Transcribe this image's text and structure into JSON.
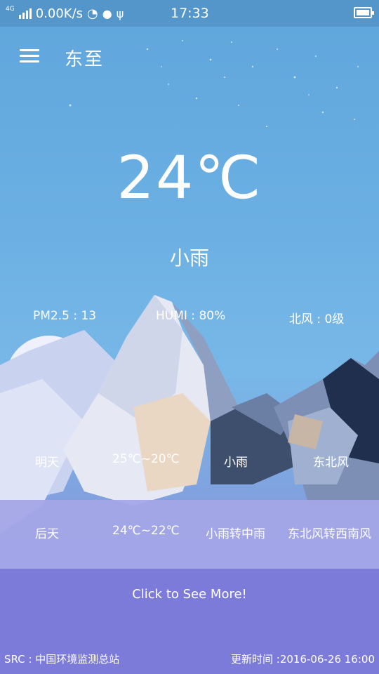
{
  "status_bar": {
    "network": "4G",
    "speed": "0.00K/s",
    "time": "17:33"
  },
  "header": {
    "city": "东至"
  },
  "current": {
    "temperature": "24℃",
    "condition": "小雨"
  },
  "metrics": [
    {
      "label": "PM2.5 : 13"
    },
    {
      "label": "HUMI : 80%"
    },
    {
      "label": "北风 : 0级"
    }
  ],
  "forecast": [
    {
      "day": "明天",
      "temp": "25℃~20℃",
      "weather": "小雨",
      "wind": "东北风"
    },
    {
      "day": "后天",
      "temp": "24℃~22℃",
      "weather": "小雨转中雨",
      "wind": "东北风转西南风"
    }
  ],
  "more_link": "Click to See More!",
  "footer": {
    "source": "SRC : 中国环境监测总站",
    "updated": "更新时间 :2016-06-26 16:00"
  },
  "colors": {
    "sky_top": "#5fa6dc",
    "sky_mid": "#78b8e8",
    "ground": "#7a7ad8"
  }
}
